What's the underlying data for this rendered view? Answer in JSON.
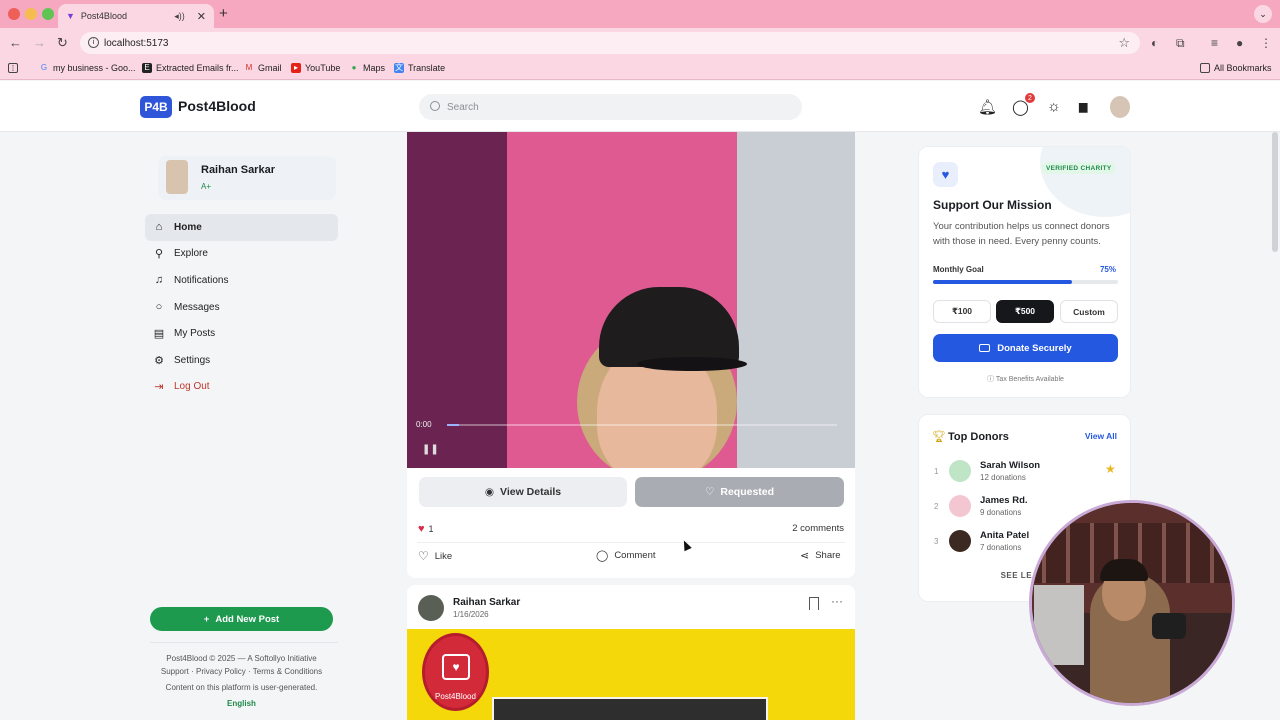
{
  "browser": {
    "tab_title": "Post4Blood",
    "url": "localhost:5173",
    "bookmarks": [
      "my business - Goo...",
      "Extracted Emails fr...",
      "Gmail",
      "YouTube",
      "Maps",
      "Translate"
    ],
    "all_bookmarks": "All Bookmarks"
  },
  "header": {
    "logo_badge": "P4B",
    "logo_text": "Post4Blood",
    "search_placeholder": "Search",
    "message_count": "2"
  },
  "profile": {
    "name": "Raihan Sarkar",
    "blood_group": "A+"
  },
  "menu": {
    "items": [
      "Home",
      "Explore",
      "Notifications",
      "Messages",
      "My Posts",
      "Settings",
      "Log Out"
    ]
  },
  "sidebar_footer": {
    "add_post": "Add New Post",
    "copyright": "Post4Blood © 2025 — A Softollyo Initiative",
    "support": "Support",
    "privacy": "Privacy Policy",
    "terms": "Terms & Conditions",
    "disclaimer": "Content on this platform is user-generated.",
    "language": "English"
  },
  "post1": {
    "video_time": "0:00",
    "video_progress": 0.03,
    "view_details": "View Details",
    "requested": "Requested",
    "like_count": "1",
    "comments": "2 comments",
    "like": "Like",
    "comment": "Comment",
    "share": "Share"
  },
  "post2": {
    "author": "Raihan Sarkar",
    "date": "1/16/2026",
    "logo_text": "Post4Blood"
  },
  "mission": {
    "badge": "VERIFIED CHARITY",
    "title": "Support Our Mission",
    "description": "Your contribution helps us connect donors with those in need. Every penny counts.",
    "goal_label": "Monthly Goal",
    "goal_pct_label": "75%",
    "goal_value": 0.75,
    "amounts": [
      "₹100",
      "₹500",
      "Custom"
    ],
    "selected_amount": 1,
    "donate": "Donate Securely",
    "tax": "Tax Benefits Available"
  },
  "donors": {
    "title": "Top Donors",
    "view_all": "View All",
    "list": [
      {
        "rank": "1",
        "name": "Sarah Wilson",
        "count": "12 donations"
      },
      {
        "rank": "2",
        "name": "James Rd.",
        "count": "9 donations"
      },
      {
        "rank": "3",
        "name": "Anita Patel",
        "count": "7 donations"
      }
    ],
    "see_leaderboard": "SEE LEADE"
  },
  "colors": {
    "brand": "#2f56d8",
    "accent_green": "#1e9a4f",
    "chrome_pink": "#f5a8c0"
  }
}
